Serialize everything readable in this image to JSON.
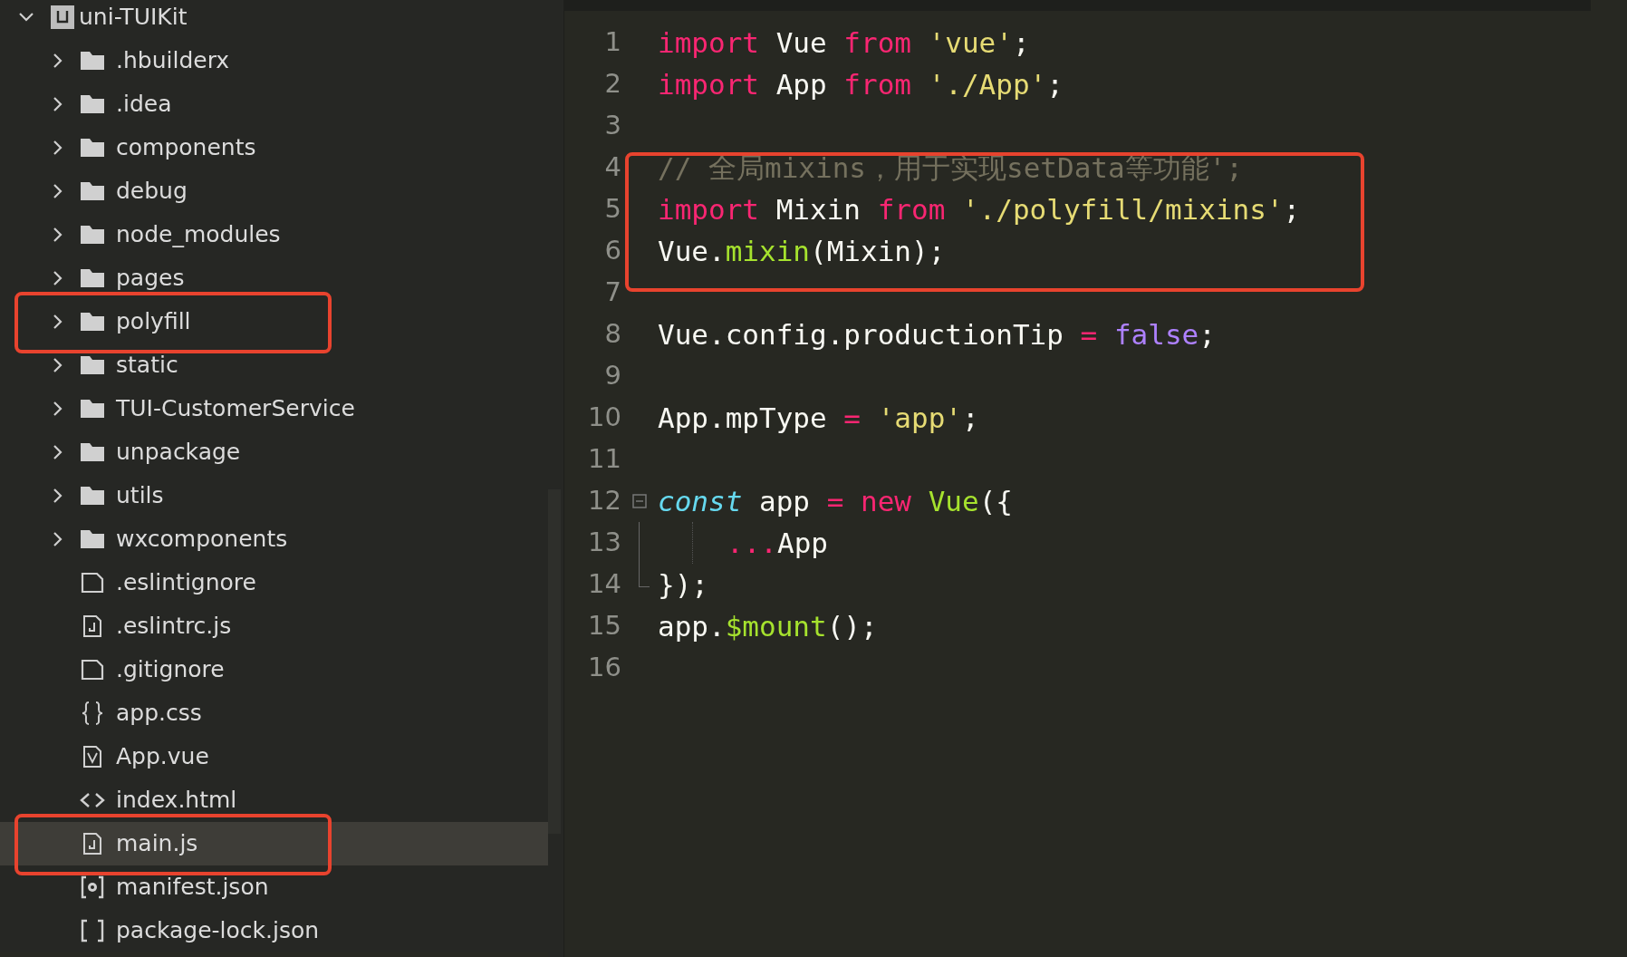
{
  "explorer": {
    "root": {
      "label": "uni-TUIKit",
      "expanded": true,
      "children": [
        {
          "label": ".hbuilderx",
          "kind": "folder",
          "expanded": false,
          "selected": false,
          "highlighted": false
        },
        {
          "label": ".idea",
          "kind": "folder",
          "expanded": false,
          "selected": false,
          "highlighted": false
        },
        {
          "label": "components",
          "kind": "folder",
          "expanded": false,
          "selected": false,
          "highlighted": false
        },
        {
          "label": "debug",
          "kind": "folder",
          "expanded": false,
          "selected": false,
          "highlighted": false
        },
        {
          "label": "node_modules",
          "kind": "folder",
          "expanded": false,
          "selected": false,
          "highlighted": false
        },
        {
          "label": "pages",
          "kind": "folder",
          "expanded": false,
          "selected": false,
          "highlighted": false
        },
        {
          "label": "polyfill",
          "kind": "folder",
          "expanded": false,
          "selected": false,
          "highlighted": true
        },
        {
          "label": "static",
          "kind": "folder",
          "expanded": false,
          "selected": false,
          "highlighted": false
        },
        {
          "label": "TUI-CustomerService",
          "kind": "folder",
          "expanded": false,
          "selected": false,
          "highlighted": false
        },
        {
          "label": "unpackage",
          "kind": "folder",
          "expanded": false,
          "selected": false,
          "highlighted": false
        },
        {
          "label": "utils",
          "kind": "folder",
          "expanded": false,
          "selected": false,
          "highlighted": false
        },
        {
          "label": "wxcomponents",
          "kind": "folder",
          "expanded": false,
          "selected": false,
          "highlighted": false
        },
        {
          "label": ".eslintignore",
          "kind": "plain",
          "selected": false,
          "highlighted": false
        },
        {
          "label": ".eslintrc.js",
          "kind": "script",
          "selected": false,
          "highlighted": false
        },
        {
          "label": ".gitignore",
          "kind": "plain",
          "selected": false,
          "highlighted": false
        },
        {
          "label": "app.css",
          "kind": "style",
          "selected": false,
          "highlighted": false
        },
        {
          "label": "App.vue",
          "kind": "vue",
          "selected": false,
          "highlighted": false
        },
        {
          "label": "index.html",
          "kind": "markup",
          "selected": false,
          "highlighted": false
        },
        {
          "label": "main.js",
          "kind": "script",
          "selected": true,
          "highlighted": true
        },
        {
          "label": "manifest.json",
          "kind": "config",
          "selected": false,
          "highlighted": false
        },
        {
          "label": "package-lock.json",
          "kind": "array",
          "selected": false,
          "highlighted": false
        }
      ]
    }
  },
  "editor": {
    "lines": [
      {
        "number": "1",
        "highlighted": false,
        "tokens": [
          {
            "kind": "keyword",
            "text": "import"
          },
          {
            "kind": "plain",
            "text": " Vue "
          },
          {
            "kind": "keyword",
            "text": "from"
          },
          {
            "kind": "string",
            "text": " 'vue'"
          },
          {
            "kind": "plain",
            "text": ";"
          }
        ]
      },
      {
        "number": "2",
        "highlighted": false,
        "tokens": [
          {
            "kind": "keyword",
            "text": "import"
          },
          {
            "kind": "plain",
            "text": " App "
          },
          {
            "kind": "keyword",
            "text": "from"
          },
          {
            "kind": "string",
            "text": " './App'"
          },
          {
            "kind": "plain",
            "text": ";"
          }
        ]
      },
      {
        "number": "3",
        "highlighted": false
      },
      {
        "number": "4",
        "highlighted": true,
        "tokens": [
          {
            "kind": "comment",
            "text": "// 全局mixins，用于实现setData等功能';"
          }
        ]
      },
      {
        "number": "5",
        "highlighted": true,
        "tokens": [
          {
            "kind": "keyword",
            "text": "import"
          },
          {
            "kind": "plain",
            "text": " Mixin "
          },
          {
            "kind": "keyword",
            "text": "from"
          },
          {
            "kind": "string",
            "text": " './polyfill/mixins'"
          },
          {
            "kind": "plain",
            "text": ";"
          }
        ]
      },
      {
        "number": "6",
        "highlighted": true,
        "tokens": [
          {
            "kind": "plain",
            "text": "Vue."
          },
          {
            "kind": "function",
            "text": "mixin"
          },
          {
            "kind": "plain",
            "text": "(Mixin);"
          }
        ]
      },
      {
        "number": "7",
        "highlighted": false
      },
      {
        "number": "8",
        "highlighted": false,
        "tokens": [
          {
            "kind": "plain",
            "text": "Vue.config.productionTip "
          },
          {
            "kind": "keyword",
            "text": "= "
          },
          {
            "kind": "constant",
            "text": "false"
          },
          {
            "kind": "plain",
            "text": ";"
          }
        ]
      },
      {
        "number": "9",
        "highlighted": false
      },
      {
        "number": "10",
        "highlighted": false,
        "tokens": [
          {
            "kind": "plain",
            "text": "App.mpType "
          },
          {
            "kind": "keyword",
            "text": "= "
          },
          {
            "kind": "string",
            "text": "'app'"
          },
          {
            "kind": "plain",
            "text": ";"
          }
        ]
      },
      {
        "number": "11",
        "highlighted": false
      },
      {
        "number": "12",
        "highlighted": false,
        "folded": false,
        "tokens": [
          {
            "kind": "storage",
            "text": "const"
          },
          {
            "kind": "plain",
            "text": " app "
          },
          {
            "kind": "keyword",
            "text": "= new "
          },
          {
            "kind": "function",
            "text": "Vue"
          },
          {
            "kind": "plain",
            "text": "({"
          }
        ]
      },
      {
        "number": "13",
        "highlighted": false,
        "fold_guide": true,
        "tokens": [
          {
            "kind": "keyword",
            "text": "..."
          },
          {
            "kind": "plain",
            "text": "App"
          }
        ]
      },
      {
        "number": "14",
        "highlighted": false,
        "fold_end": true,
        "tokens": [
          {
            "kind": "plain",
            "text": "});"
          }
        ]
      },
      {
        "number": "15",
        "highlighted": false,
        "tokens": [
          {
            "kind": "plain",
            "text": "app."
          },
          {
            "kind": "function",
            "text": "$mount"
          },
          {
            "kind": "plain",
            "text": "();"
          }
        ]
      },
      {
        "number": "16",
        "highlighted": false
      }
    ]
  }
}
